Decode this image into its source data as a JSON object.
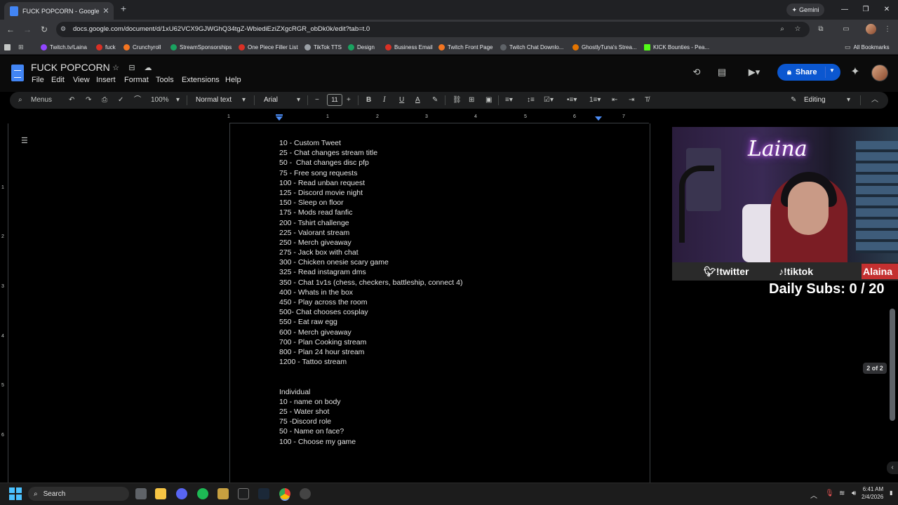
{
  "browser": {
    "tab_title": "FUCK POPCORN - Google Docs",
    "tab_close": "✕",
    "new_tab": "+",
    "gemini_label": "Gemini",
    "url": "docs.google.com/document/d/1xU62VCX9GJWGhQ34tgZ-WbiediEziZXgcRGR_obDk0k/edit?tab=t.0",
    "bookmarks": [
      {
        "label": "Twitch.tv/Laina",
        "color": "#9146ff"
      },
      {
        "label": "fuck",
        "color": "#d93025"
      },
      {
        "label": "Crunchyroll",
        "color": "#f47521"
      },
      {
        "label": "StreamSponsorships",
        "color": "#1aa260"
      },
      {
        "label": "One Piece Filler List",
        "color": "#d93025"
      },
      {
        "label": "TikTok TTS",
        "color": "#9aa0a6"
      },
      {
        "label": "Design",
        "color": "#1aa260"
      },
      {
        "label": "Business Email",
        "color": "#d93025"
      },
      {
        "label": "Twitch Front Page",
        "color": "#f47521"
      },
      {
        "label": "Twitch Chat Downlo...",
        "color": "#5f6368"
      },
      {
        "label": "GhostlyTuna's Strea...",
        "color": "#e37400"
      },
      {
        "label": "KICK Bounties - Pea...",
        "color": "#53fc18"
      }
    ],
    "all_bookmarks": "All Bookmarks"
  },
  "docs": {
    "title": "FUCK POPCORN",
    "menu": [
      "File",
      "Edit",
      "View",
      "Insert",
      "Format",
      "Tools",
      "Extensions",
      "Help"
    ],
    "share_label": "Share",
    "toolbar": {
      "search_menus": "Menus",
      "zoom": "100%",
      "style": "Normal text",
      "font": "Arial",
      "font_size": "11",
      "bold": "B",
      "italic": "I",
      "underline": "U",
      "text_color": "A",
      "mode": "Editing"
    },
    "ruler_numbers": [
      "1",
      "1",
      "2",
      "3",
      "4",
      "5",
      "6",
      "7"
    ],
    "vruler_numbers": [
      "1",
      "2",
      "3",
      "4",
      "5",
      "6"
    ],
    "lines": [
      "10 - Custom Tweet",
      "25 - Chat changes stream title",
      "50 -  Chat changes disc pfp",
      "75 - Free song requests",
      "100 - Read unban request",
      "125 - Discord movie night",
      "150 - Sleep on floor",
      "175 - Mods read fanfic",
      "200 - Tshirt challenge",
      "225 - Valorant stream",
      "250 - Merch giveaway",
      "275 - Jack box with chat",
      "300 - Chicken onesie scary game",
      "325 - Read instagram dms",
      "350 - Chat 1v1s (chess, checkers, battleship, connect 4)",
      "400 - Whats in the box",
      "450 - Play across the room",
      "500- Chat chooses cosplay",
      "550 - Eat raw egg",
      "600 - Merch giveaway",
      "700 - Plan Cooking stream",
      "800 - Plan 24 hour stream",
      "1200 - Tattoo stream"
    ],
    "lines2": [
      "Individual",
      "10 - name on body",
      "25 - Water shot",
      "75 -Discord role",
      "50 - Name on face?",
      "100 - Choose my game"
    ],
    "page_indicator": "2 of 2"
  },
  "stream_overlay": {
    "sign": "Laina",
    "twitter": "!twitter",
    "tiktok": "!tiktok",
    "name_tag": "Alaina",
    "daily_subs": "Daily Subs: 0 / 20"
  },
  "taskbar": {
    "search": "Search",
    "time": "6:41 AM",
    "date": "2/4/2026"
  }
}
